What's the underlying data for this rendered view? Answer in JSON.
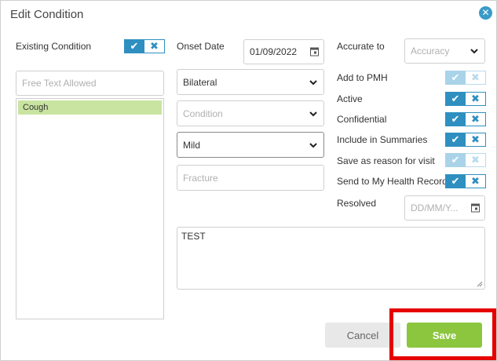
{
  "dialog": {
    "title": "Edit Condition",
    "close_icon": "close-icon"
  },
  "left": {
    "existing_condition_label": "Existing Condition",
    "existing_condition_value": "yes",
    "free_text_placeholder": "Free Text Allowed",
    "conditions": [
      "Cough"
    ]
  },
  "middle": {
    "onset_date_label": "Onset Date",
    "onset_date_value": "01/09/2022",
    "laterality_value": "Bilateral",
    "condition_placeholder": "Condition",
    "severity_value": "Mild",
    "fracture_placeholder": "Fracture"
  },
  "right": {
    "accurate_to_label": "Accurate to",
    "accuracy_placeholder": "Accuracy",
    "toggles": [
      {
        "label": "Add to PMH",
        "state": "disabled"
      },
      {
        "label": "Active",
        "state": "yes"
      },
      {
        "label": "Confidential",
        "state": "yes"
      },
      {
        "label": "Include in Summaries",
        "state": "yes"
      },
      {
        "label": "Save as reason for visit",
        "state": "disabled"
      },
      {
        "label": "Send to My Health Record",
        "state": "yes"
      }
    ],
    "resolved_label": "Resolved",
    "resolved_placeholder": "DD/MM/Y..."
  },
  "notes": {
    "value": "TEST"
  },
  "footer": {
    "cancel_label": "Cancel",
    "save_label": "Save"
  },
  "colors": {
    "accent": "#2f8fc0",
    "save": "#8cc63f",
    "selected_row": "#c9e4a1",
    "highlight": "#e60000"
  }
}
